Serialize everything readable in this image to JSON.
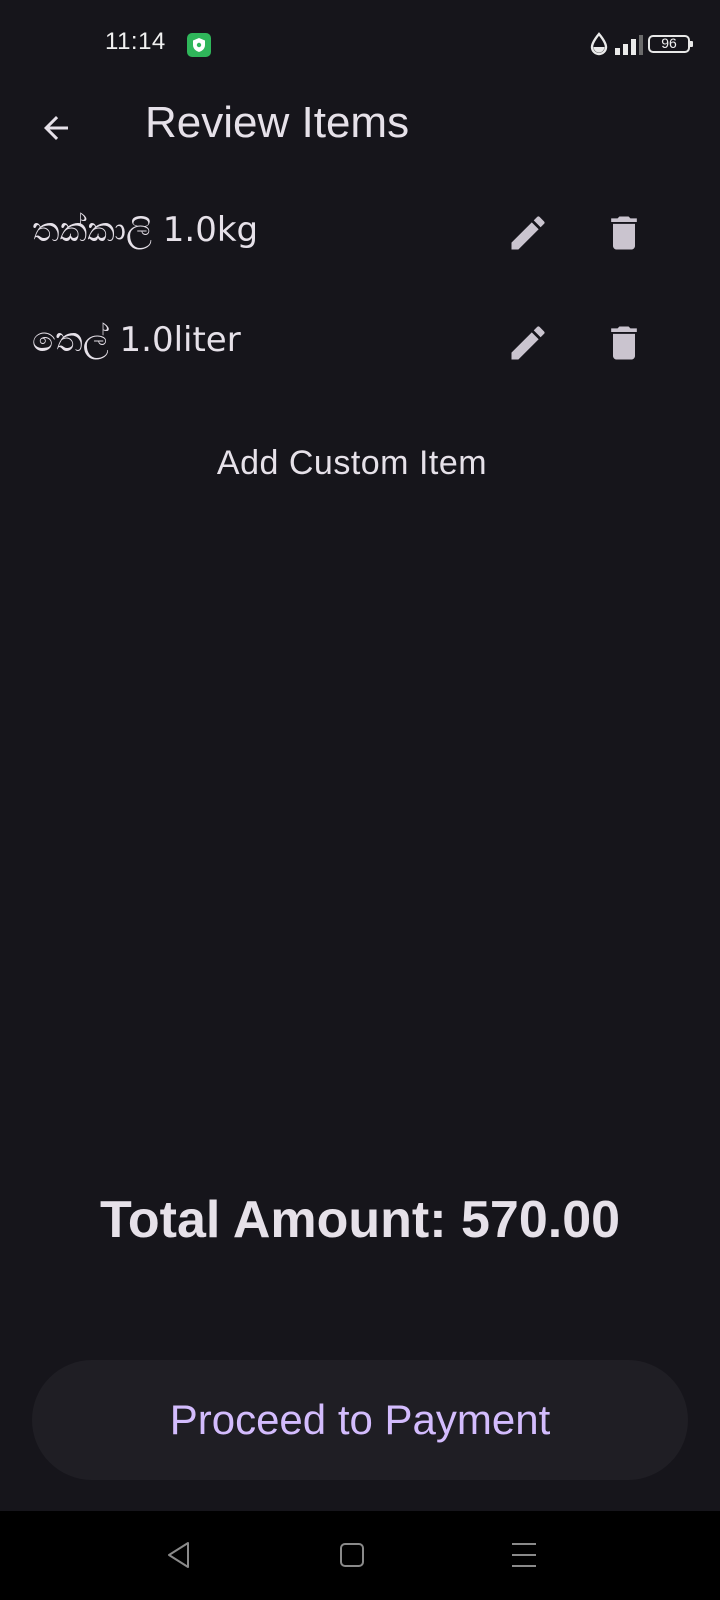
{
  "status_bar": {
    "time": "11:14",
    "battery": "96"
  },
  "header": {
    "title": "Review Items",
    "back_icon": "arrow-left-icon"
  },
  "items": [
    {
      "label": "තක්කාලි 1.0kg",
      "edit_icon": "pencil-icon",
      "delete_icon": "trash-icon"
    },
    {
      "label": "තෙල් 1.0liter",
      "edit_icon": "pencil-icon",
      "delete_icon": "trash-icon"
    }
  ],
  "add_custom_label": "Add Custom Item",
  "total": {
    "text": "Total Amount: 570.00"
  },
  "proceed_label": "Proceed to Payment",
  "colors": {
    "background": "#16151b",
    "text": "#e6e1e9",
    "accent": "#d3bcfd",
    "button_surface": "#1f1e24",
    "icon": "#cac4cf"
  },
  "nav_bar": {
    "icons": [
      "triangle-back-icon",
      "square-home-icon",
      "menu-recents-icon"
    ]
  }
}
